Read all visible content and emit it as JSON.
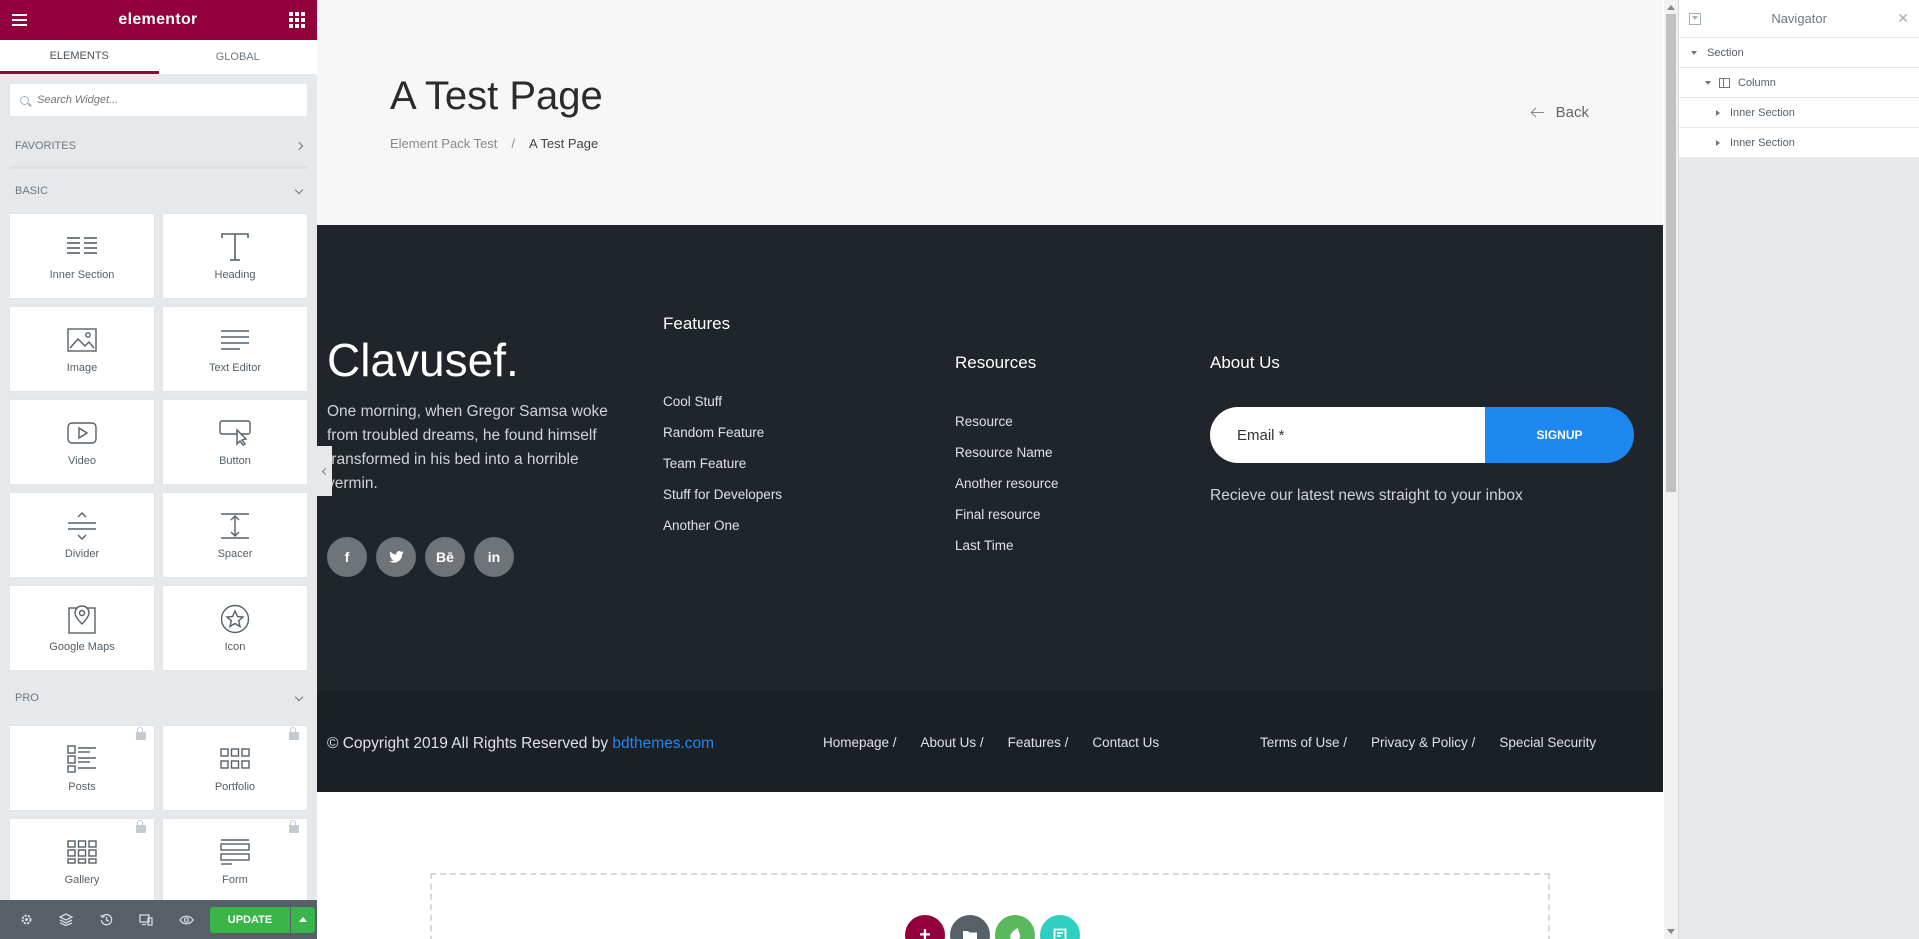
{
  "panel": {
    "logo": "elementor",
    "tabs": [
      {
        "label": "ELEMENTS"
      },
      {
        "label": "GLOBAL"
      }
    ],
    "search_placeholder": "Search Widget...",
    "categories": {
      "favorites": "FAVORITES",
      "basic": "BASIC",
      "pro": "PRO"
    },
    "basic_widgets": [
      {
        "label": "Inner Section",
        "icon": "inner-section-icon"
      },
      {
        "label": "Heading",
        "icon": "heading-icon"
      },
      {
        "label": "Image",
        "icon": "image-icon"
      },
      {
        "label": "Text Editor",
        "icon": "text-editor-icon"
      },
      {
        "label": "Video",
        "icon": "video-icon"
      },
      {
        "label": "Button",
        "icon": "button-icon"
      },
      {
        "label": "Divider",
        "icon": "divider-icon"
      },
      {
        "label": "Spacer",
        "icon": "spacer-icon"
      },
      {
        "label": "Google Maps",
        "icon": "google-maps-icon"
      },
      {
        "label": "Icon",
        "icon": "star-icon"
      }
    ],
    "pro_widgets": [
      {
        "label": "Posts",
        "icon": "posts-icon"
      },
      {
        "label": "Portfolio",
        "icon": "portfolio-icon"
      },
      {
        "label": "Gallery",
        "icon": "gallery-icon"
      },
      {
        "label": "Form",
        "icon": "form-icon"
      }
    ],
    "footer": {
      "update_label": "UPDATE"
    }
  },
  "page": {
    "title": "A Test Page",
    "breadcrumb": {
      "parent": "Element Pack Test",
      "separator": "/",
      "current": "A Test Page"
    },
    "back_label": "Back",
    "footer": {
      "brand": "Clavusef.",
      "about_text": "One morning, when Gregor Samsa woke from troubled dreams, he found himself transformed in his bed into a horrible vermin.",
      "socials": [
        {
          "label": "f",
          "icon": "facebook-icon"
        },
        {
          "label": "🐦",
          "icon": "twitter-icon"
        },
        {
          "label": "Bē",
          "icon": "behance-icon"
        },
        {
          "label": "in",
          "icon": "linkedin-icon"
        }
      ],
      "features": {
        "title": "Features",
        "links": [
          "Cool Stuff",
          "Random Feature",
          "Team Feature",
          "Stuff for Developers",
          "Another One"
        ]
      },
      "resources": {
        "title": "Resources",
        "links": [
          "Resource",
          "Resource Name",
          "Another resource",
          "Final resource",
          "Last Time"
        ]
      },
      "about_us": {
        "title": "About Us",
        "email_placeholder": "Email *",
        "signup_label": "SIGNUP",
        "note": "Recieve our latest news straight to your inbox"
      },
      "copyright": {
        "text": "© Copyright 2019 All Rights Reserved by",
        "link": "bdthemes.com"
      },
      "menu1": [
        "Homepage /",
        "About Us /",
        "Features /",
        "Contact Us"
      ],
      "menu2": [
        "Terms of Use /",
        "Privacy & Policy /",
        "Special Security"
      ]
    },
    "add_buttons": [
      {
        "label": "+",
        "color": "#93003c",
        "icon": "plus-icon"
      },
      {
        "label": "",
        "color": "#556068",
        "icon": "folder-icon"
      },
      {
        "label": "",
        "color": "#71d7f7",
        "icon": "envato-icon"
      },
      {
        "label": "",
        "color": "#2ecfb5",
        "icon": "template-icon"
      }
    ]
  },
  "navigator": {
    "title": "Navigator",
    "items": [
      {
        "label": "Section",
        "level": 0
      },
      {
        "label": "Column",
        "level": 1
      },
      {
        "label": "Inner Section",
        "level": 2
      },
      {
        "label": "Inner Section",
        "level": 2
      }
    ]
  },
  "colors": {
    "brand": "#93003c",
    "update_green": "#39b54a",
    "accent_blue": "#1e87f0",
    "footer_dark": "#1f252b"
  }
}
